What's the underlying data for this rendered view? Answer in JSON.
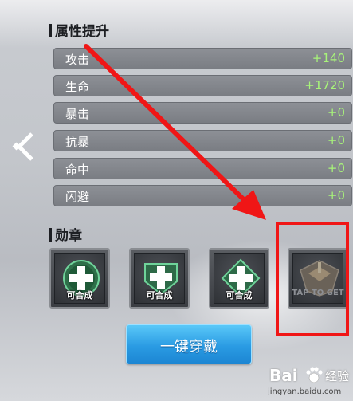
{
  "attributes": {
    "title": "属性提升",
    "rows": [
      {
        "label": "攻击",
        "value": "+140"
      },
      {
        "label": "生命",
        "value": "+1720"
      },
      {
        "label": "暴击",
        "value": "+0"
      },
      {
        "label": "抗暴",
        "value": "+0"
      },
      {
        "label": "命中",
        "value": "+0"
      },
      {
        "label": "闪避",
        "value": "+0"
      }
    ]
  },
  "medals": {
    "title": "勋章",
    "slots": [
      {
        "caption": "可合成",
        "icon": "plus-shield-icon"
      },
      {
        "caption": "可合成",
        "icon": "plus-shield-icon"
      },
      {
        "caption": "可合成",
        "icon": "plus-shield-icon"
      },
      {
        "caption": "TAP TO GET",
        "icon": "rank-badge-icon"
      }
    ]
  },
  "equip_button": {
    "label": "一键穿戴"
  },
  "watermark": {
    "brand": "Bai",
    "brand_cn": "经验",
    "url": "jingyan.baidu.com"
  },
  "colors": {
    "value_green": "#a8f47a",
    "button_blue": "#2a9be3",
    "annotation_red": "#f01616"
  }
}
